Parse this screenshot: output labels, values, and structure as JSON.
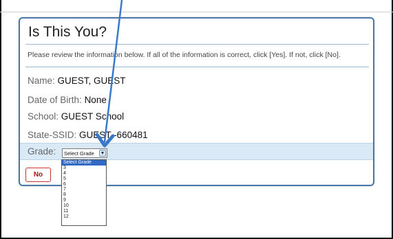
{
  "dialog": {
    "title": "Is This You?",
    "instructions": "Please review the information below. If all of the information is correct, click [Yes]. If not, click [No].",
    "fields": [
      {
        "label": "Name:",
        "value": "GUEST, GUEST"
      },
      {
        "label": "Date of Birth:",
        "value": "None"
      },
      {
        "label": "School:",
        "value": "GUEST School"
      },
      {
        "label": "State-SSID:",
        "value": "GUEST -660481"
      }
    ],
    "grade": {
      "label": "Grade:",
      "selected": "Select Grade",
      "options": [
        "Select Grade",
        "3",
        "4",
        "5",
        "6",
        "7",
        "8",
        "9",
        "10",
        "11",
        "12"
      ]
    },
    "no_button_label": "No"
  },
  "colors": {
    "dialog_border": "#4a79a8",
    "grade_row_bg": "#d9eaf6",
    "no_button": "#cc3333",
    "arrow": "#3a78c9",
    "dropdown_selected": "#3169c6"
  },
  "icons": {
    "select_arrow": "chevron-down-icon",
    "annotation": "arrow-pointer-icon"
  }
}
